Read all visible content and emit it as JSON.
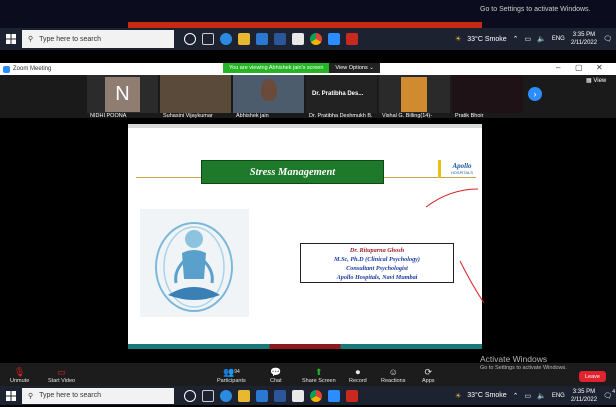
{
  "top_watermark": "Go to Settings to activate Windows.",
  "taskbar": {
    "search_placeholder": "Type here to search",
    "weather": "33°C  Smoke",
    "time": "3:35 PM",
    "date": "2/11/2022",
    "notification_count": "4"
  },
  "zoom": {
    "window_title": "Zoom Meeting",
    "viewing_text": "You are viewing Abhishek jain's screen",
    "view_options": "View Options ⌄",
    "view_label": "View",
    "participants": [
      "NIDHI POONA",
      "Suhasini Vijaykumar",
      "Abhishek jain",
      "Dr. Pratibha Deshmukh B.",
      "Vishal G. Billing(14)-",
      "Pratik Bhoir"
    ],
    "tile4_overlay": "Dr. Pratibha Des..."
  },
  "slide": {
    "title": "Stress Management",
    "logo_text": "Apollo",
    "logo_sub": "HOSPITALS",
    "info_lines": [
      "Dr. Rituparna Ghosh",
      "M.Sc, Ph.D (Clinical Psychology)",
      "Consultant Psychologist",
      "Apollo Hospitals, Navi Mumbai"
    ]
  },
  "toolbar": {
    "unmute": "Unmute",
    "start_video": "Start Video",
    "participants": "Participants",
    "participants_count": "94",
    "chat": "Chat",
    "share_screen": "Share Screen",
    "record": "Record",
    "reactions": "Reactions",
    "apps": "Apps",
    "leave": "Leave"
  },
  "activate": {
    "title": "Activate Windows",
    "sub": "Go to Settings to activate Windows."
  },
  "colors": {
    "accent_green": "#24b424",
    "leave_red": "#e0232e",
    "slide_title_bg": "#1e7a2a"
  }
}
